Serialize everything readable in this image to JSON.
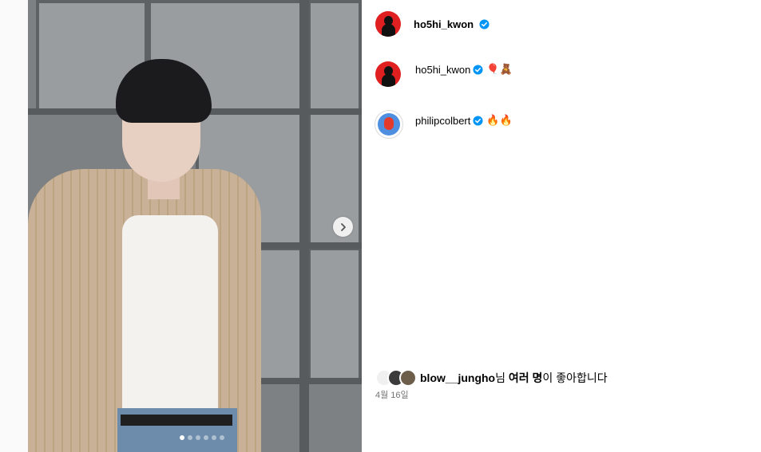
{
  "header": {
    "username": "ho5hi_kwon",
    "verified": true
  },
  "comments": [
    {
      "username": "ho5hi_kwon",
      "verified": true,
      "text": "🎈🧸"
    },
    {
      "username": "philipcolbert",
      "verified": true,
      "text": "🔥🔥"
    }
  ],
  "likes": {
    "user": "blow__jungho",
    "suffix": "님 ",
    "others": "여러 명",
    "tail": "이 좋아합니다"
  },
  "date": "4월 16일",
  "media": {
    "carousel_dots": 6,
    "active_dot": 1
  },
  "icons": {
    "next": "chevron-right-icon",
    "verified": "verified-badge-icon"
  },
  "colors": {
    "verified": "#0095f6",
    "avatar_bg": "#e02020",
    "muted_text": "#737373"
  }
}
